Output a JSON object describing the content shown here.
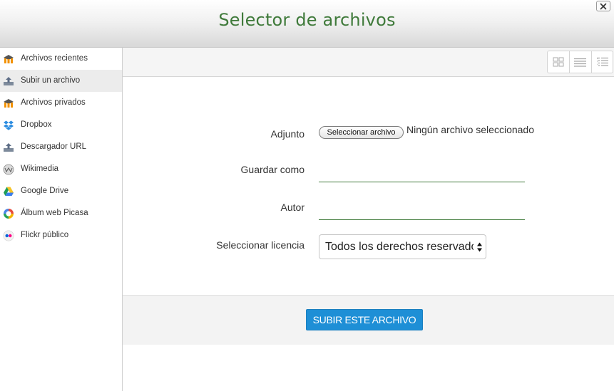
{
  "dialog": {
    "title": "Selector de archivos",
    "close_icon": "close-icon"
  },
  "sidebar": {
    "items": [
      {
        "label": "Archivos recientes",
        "icon": "moodle-icon",
        "active": false
      },
      {
        "label": "Subir un archivo",
        "icon": "upload-icon",
        "active": true
      },
      {
        "label": "Archivos privados",
        "icon": "moodle-icon",
        "active": false
      },
      {
        "label": "Dropbox",
        "icon": "dropbox-icon",
        "active": false
      },
      {
        "label": "Descargador URL",
        "icon": "url-download-icon",
        "active": false
      },
      {
        "label": "Wikimedia",
        "icon": "wikimedia-icon",
        "active": false
      },
      {
        "label": "Google Drive",
        "icon": "google-drive-icon",
        "active": false
      },
      {
        "label": "Álbum web Picasa",
        "icon": "picasa-icon",
        "active": false
      },
      {
        "label": "Flickr público",
        "icon": "flickr-icon",
        "active": false
      }
    ]
  },
  "toolbar": {
    "views": [
      "icons-view-icon",
      "list-view-icon",
      "tree-view-icon"
    ]
  },
  "form": {
    "attachment_label": "Adjunto",
    "choose_file_button": "Seleccionar archivo",
    "file_status": "Ningún archivo seleccionado",
    "save_as_label": "Guardar como",
    "save_as_value": "",
    "author_label": "Autor",
    "author_value": "",
    "license_label": "Seleccionar licencia",
    "license_value": "Todos los derechos reservados",
    "upload_button": "SUBIR ESTE ARCHIVO"
  },
  "colors": {
    "title_green": "#3f7a3a",
    "accent_blue": "#1e8fd6"
  }
}
